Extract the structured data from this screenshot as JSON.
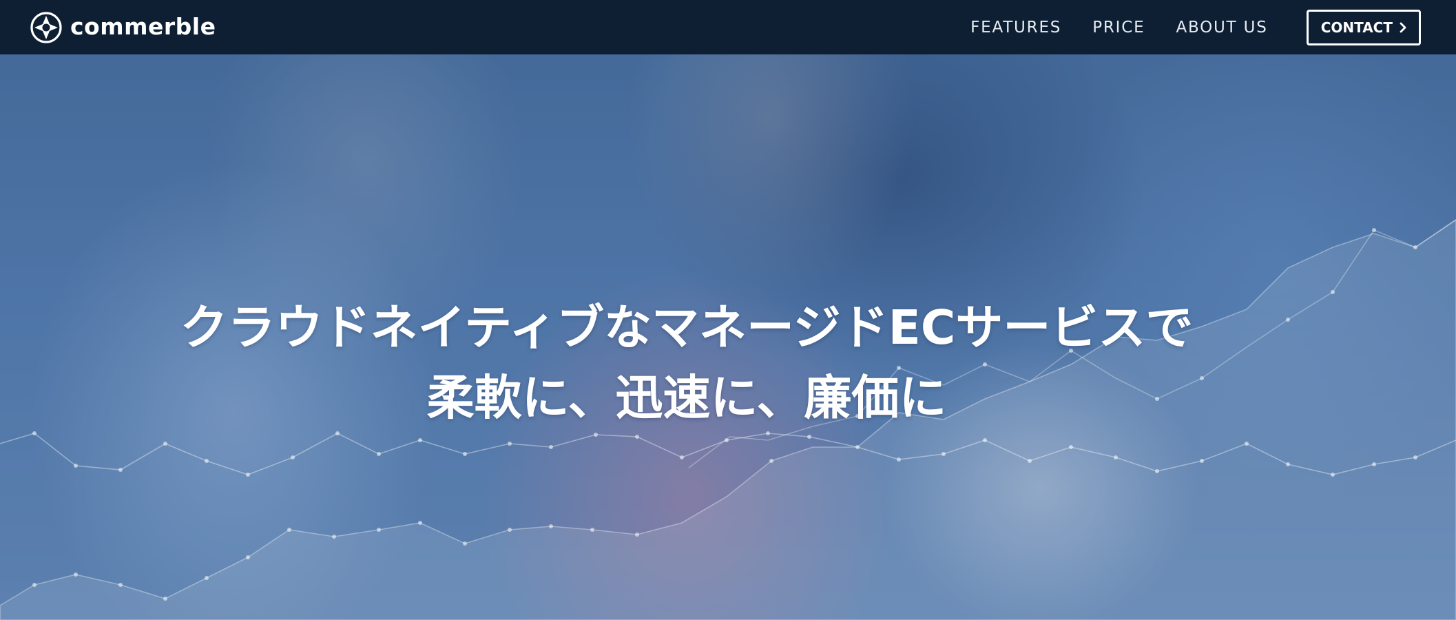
{
  "header": {
    "logo_text": "commerble",
    "nav": [
      {
        "label": "FEATURES"
      },
      {
        "label": "PRICE"
      },
      {
        "label": "ABOUT US"
      }
    ],
    "contact_label": "CONTACT"
  },
  "hero": {
    "headline_line1": "クラウドネイティブなマネージドECサービスで",
    "headline_line2": "柔軟に、迅速に、廉価に"
  },
  "colors": {
    "navbar_bg": "#0e1f34",
    "hero_tint": "#4f77a8",
    "text": "#ffffff"
  },
  "icons": {
    "logo": "commerble-logo-icon",
    "contact_arrow": "chevron-right-icon"
  }
}
